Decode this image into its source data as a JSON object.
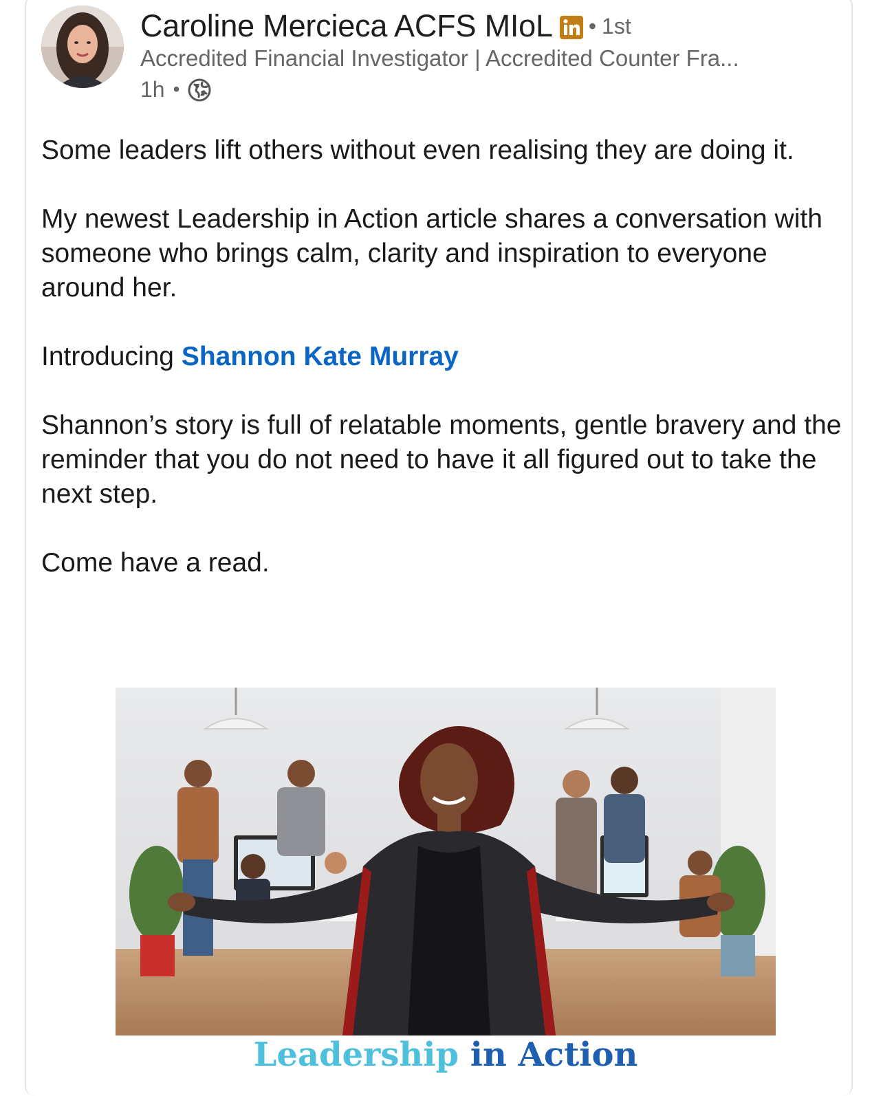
{
  "post": {
    "author": {
      "name": "Caroline Mercieca ACFS MIoL",
      "badge_icon": "linkedin-premium-icon",
      "connection_separator": "•",
      "connection_degree": "1st",
      "headline": "Accredited Financial Investigator | Accredited Counter Fra...",
      "time": "1h",
      "meta_separator": "•",
      "visibility_icon": "globe-icon"
    },
    "body": {
      "p1": "Some leaders lift others without even realising they are doing it.",
      "p2": "My newest Leadership in Action article shares a conversation with someone who brings calm, clarity and inspiration to everyone around her.",
      "p3_prefix": "Introducing ",
      "p3_mention": "Shannon Kate Murray",
      "p4": "Shannon’s story is full of relatable moments, gentle bravery and the reminder that you do not need to have it all figured out to take the next step.",
      "p5": "Come have a read."
    },
    "media": {
      "caption_lead": "Leadership",
      "caption_rest": " in Action"
    }
  },
  "colors": {
    "mention": "#0a66c2",
    "premium_badge": "#c37d16",
    "caption_lead": "#4ec0dc",
    "caption_rest": "#1f5fb0",
    "meta_text": "#666666"
  }
}
